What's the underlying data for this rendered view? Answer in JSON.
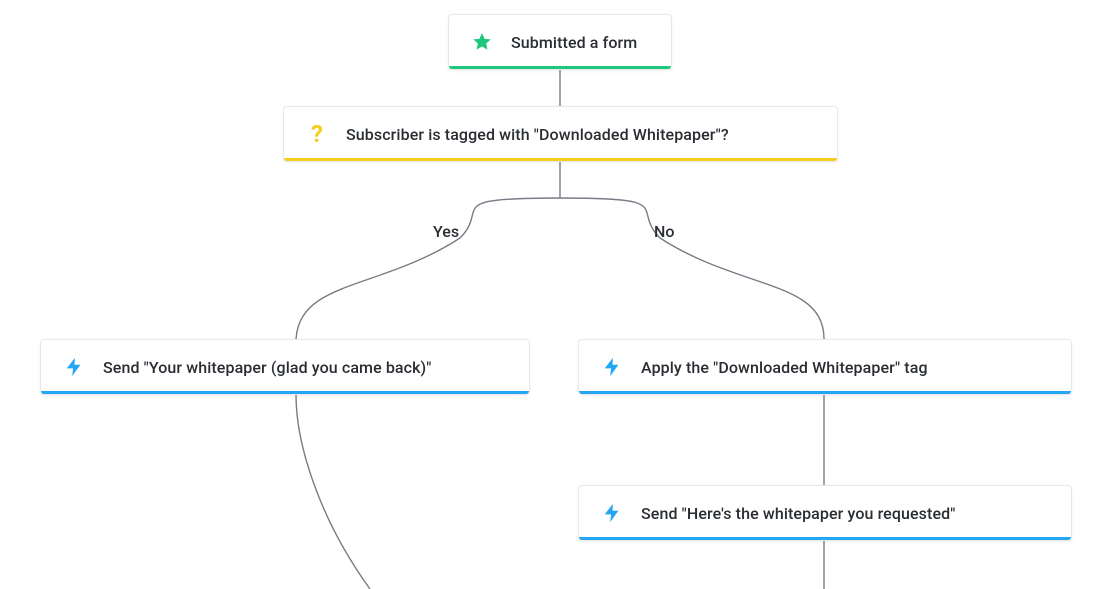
{
  "colors": {
    "green": "#1ec77b",
    "yellow": "#f6cc1d",
    "blue": "#23a7f2",
    "connector": "#777d85",
    "text": "#2a2e33"
  },
  "trigger": {
    "label": "Submitted a form",
    "icon": "star-icon"
  },
  "condition": {
    "label": "Subscriber is tagged with \"Downloaded Whitepaper\"?",
    "icon": "question-icon"
  },
  "branches": {
    "yes_label": "Yes",
    "no_label": "No"
  },
  "actions": {
    "yes": {
      "label": "Send \"Your whitepaper (glad you came back)\"",
      "icon": "bolt-icon"
    },
    "no_1": {
      "label": "Apply the \"Downloaded Whitepaper\" tag",
      "icon": "bolt-icon"
    },
    "no_2": {
      "label": "Send \"Here's the whitepaper you requested\"",
      "icon": "bolt-icon"
    }
  }
}
